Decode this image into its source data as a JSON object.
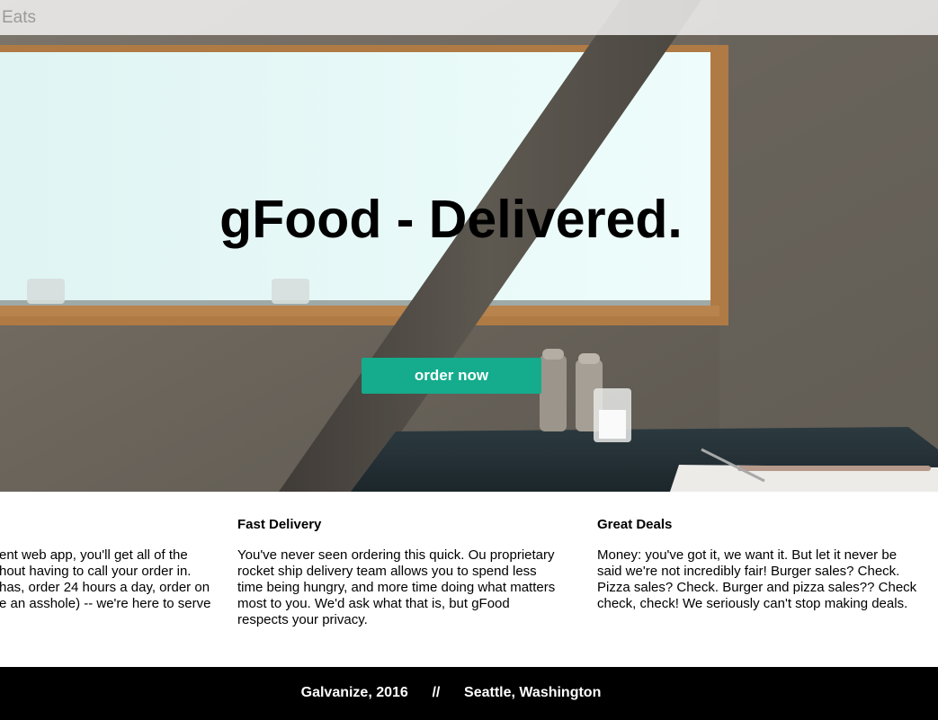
{
  "nav": {
    "brand": "Eats"
  },
  "hero": {
    "title": "gFood - Delivered.",
    "cta_label": "order now"
  },
  "features": [
    {
      "title": "",
      "lines": [
        "ent web app, you'll get all of the",
        "hout having to call your order in.",
        "has, order 24 hours a day, order on",
        "e an asshole) -- we're here to serve"
      ]
    },
    {
      "title": "Fast Delivery",
      "lines": [
        "You've never seen ordering this quick. Ou proprietary",
        "rocket ship delivery team allows you to spend less",
        "time being hungry, and more time doing what matters",
        "most to you. We'd ask what that is, but gFood",
        "respects your privacy."
      ]
    },
    {
      "title": "Great Deals",
      "lines": [
        "Money: you've got it, we want it. But let it never be",
        "said we're not incredibly fair! Burger sales? Check.",
        "Pizza sales? Check. Burger and pizza sales?? Check",
        "check, check! We seriously can't stop making deals."
      ]
    }
  ],
  "footer": {
    "left": "Galvanize, 2016",
    "separator": "//",
    "right": "Seattle, Washington"
  },
  "colors": {
    "accent": "#14ac8c",
    "footer_bg": "#000000"
  }
}
